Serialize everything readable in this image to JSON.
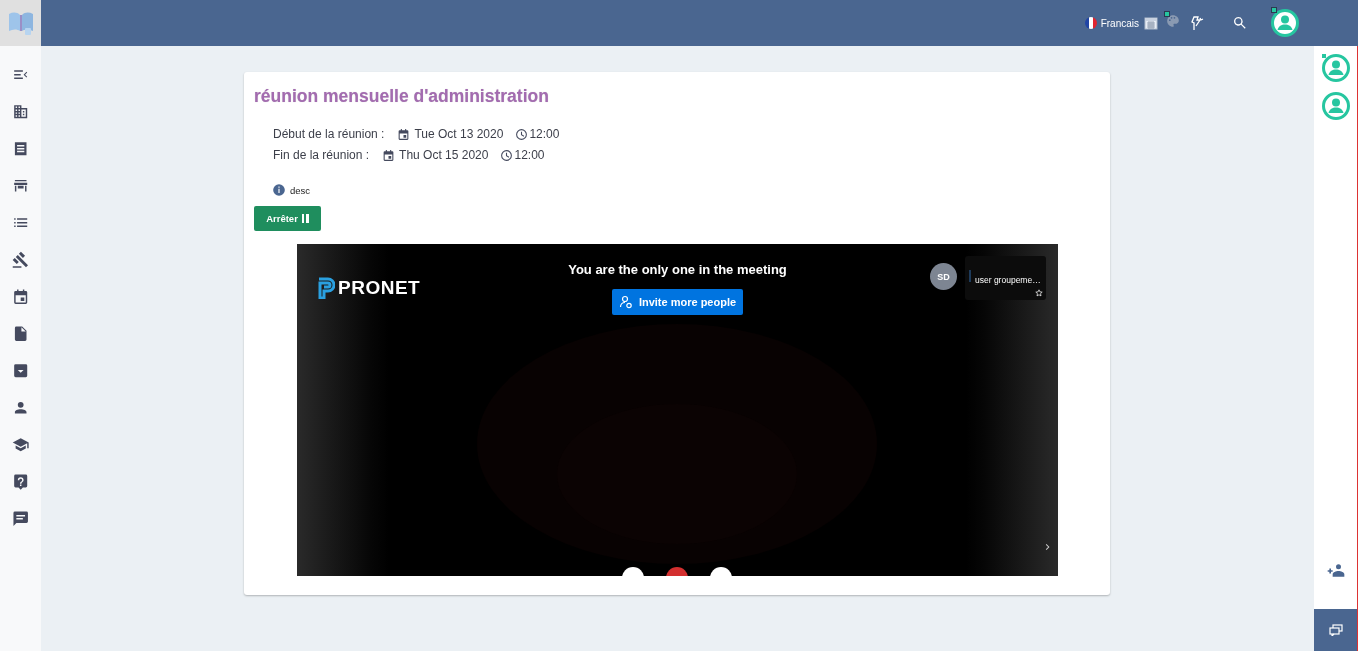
{
  "topbar": {
    "language": "Francais"
  },
  "meeting": {
    "title": "réunion mensuelle d'administration",
    "schedule": [
      {
        "label": "Début de la réunion :",
        "date": "Tue Oct 13 2020",
        "time": "12:00"
      },
      {
        "label": "Fin de la réunion :",
        "date": "Thu Oct 15 2020",
        "time": "12:00"
      }
    ],
    "description": "desc",
    "stop_button": "Arrêter"
  },
  "video": {
    "brand": "PRONET",
    "message": "You are the only one in the meeting",
    "invite_button": "Invite more people",
    "participant": {
      "initials": "SD",
      "name": "user groupeme…"
    }
  }
}
